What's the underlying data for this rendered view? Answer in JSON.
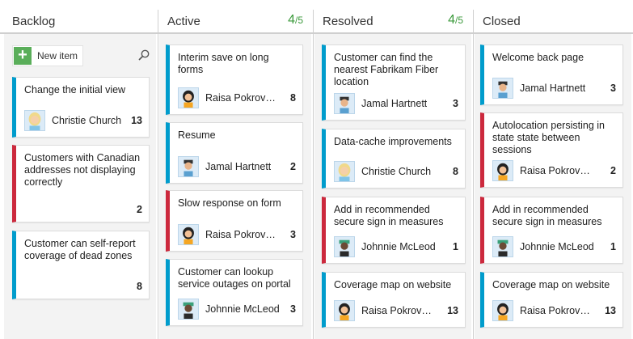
{
  "columns": [
    {
      "name": "Backlog",
      "count": "",
      "limit": ""
    },
    {
      "name": "Active",
      "count": "4",
      "limit": "/5"
    },
    {
      "name": "Resolved",
      "count": "4",
      "limit": "/5"
    },
    {
      "name": "Closed",
      "count": "",
      "limit": ""
    }
  ],
  "backlog_toolbar": {
    "new_item_label": "New item",
    "plus_icon": "+"
  },
  "cards": {
    "backlog": [
      {
        "title": "Change the initial view",
        "assignee": "Christie Church",
        "points": "13",
        "type": "story"
      },
      {
        "title": "Customers with Canadian addresses not displaying correctly",
        "assignee": "",
        "points": "2",
        "type": "bug"
      },
      {
        "title": "Customer can self-report coverage of dead zones",
        "assignee": "",
        "points": "8",
        "type": "story"
      }
    ],
    "active": [
      {
        "title": "Interim save on long forms",
        "assignee": "Raisa Pokrovsk...",
        "points": "8",
        "type": "story"
      },
      {
        "title": "Resume",
        "assignee": "Jamal Hartnett",
        "points": "2",
        "type": "story"
      },
      {
        "title": "Slow response on form",
        "assignee": "Raisa Pokrovsk...",
        "points": "3",
        "type": "bug"
      },
      {
        "title": "Customer can lookup service outages on portal",
        "assignee": "Johnnie McLeod",
        "points": "3",
        "type": "story"
      }
    ],
    "resolved": [
      {
        "title": "Customer can find the nearest Fabrikam Fiber location",
        "assignee": "Jamal Hartnett",
        "points": "3",
        "type": "story"
      },
      {
        "title": "Data-cache improvements",
        "assignee": "Christie Church",
        "points": "8",
        "type": "story"
      },
      {
        "title": "Add in recommended secure sign in measures",
        "assignee": "Johnnie McLeod",
        "points": "1",
        "type": "bug"
      },
      {
        "title": "Coverage map on website",
        "assignee": "Raisa Pokrovsk...",
        "points": "13",
        "type": "story"
      }
    ],
    "closed": [
      {
        "title": "Welcome back page",
        "assignee": "Jamal Hartnett",
        "points": "3",
        "type": "story"
      },
      {
        "title": "Autolocation persisting in state state between sessions",
        "assignee": "Raisa Pokrovsk...",
        "points": "2",
        "type": "bug"
      },
      {
        "title": "Add in recommended secure sign in measures",
        "assignee": "Johnnie McLeod",
        "points": "1",
        "type": "bug"
      },
      {
        "title": "Coverage map on website",
        "assignee": "Raisa Pokrovsk...",
        "points": "13",
        "type": "story"
      }
    ]
  },
  "colors": {
    "story": "#009ccc",
    "bug": "#cc293d",
    "wip_ok": "#3c9a3c"
  }
}
